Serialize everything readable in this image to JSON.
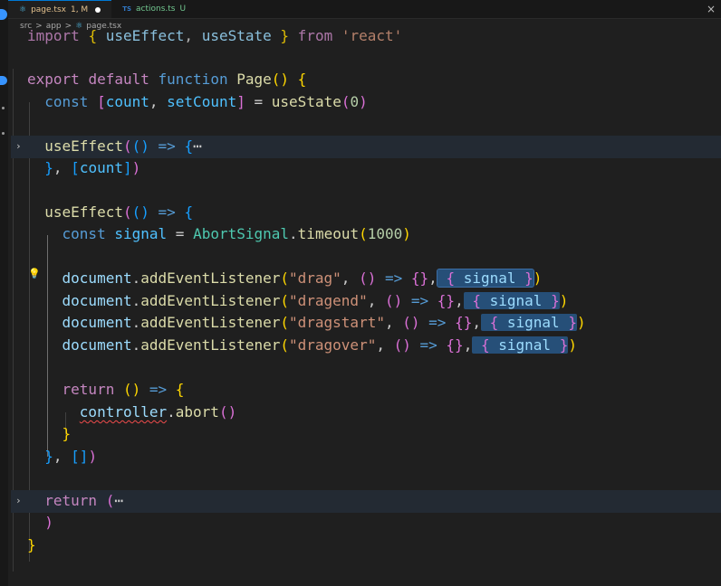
{
  "tabs": [
    {
      "name": "page.tsx",
      "status": "1, M",
      "active": true,
      "modified": true
    },
    {
      "name": "actions.ts",
      "status": "U",
      "active": false,
      "modified": false
    }
  ],
  "ts_badge": "TS",
  "close_glyph": "×",
  "breadcrumb": {
    "folder1": "src",
    "folder2": "app",
    "file": "page.tsx",
    "separator": ">"
  },
  "code": {
    "l0": [
      "import",
      "{",
      "useEffect",
      "useState",
      "}",
      "from",
      "'react'"
    ],
    "l2": [
      "export",
      "default",
      "function",
      "Page",
      "(",
      ")",
      "{"
    ],
    "l3": [
      "const",
      "[",
      "count",
      "setCount",
      "]",
      "=",
      "useState",
      "(",
      "0",
      ")"
    ],
    "l5": [
      "useEffect",
      "(",
      "(",
      ")",
      "=>",
      "{",
      "⋯"
    ],
    "l6": [
      "}",
      "[",
      "count",
      "]",
      ")"
    ],
    "l8": [
      "useEffect",
      "(",
      "(",
      ")",
      "=>",
      "{"
    ],
    "l9": [
      "const",
      "signal",
      "=",
      "AbortSignal",
      ".",
      "timeout",
      "(",
      "1000",
      ")"
    ],
    "listeners": [
      {
        "event": "\"drag\""
      },
      {
        "event": "\"dragend\""
      },
      {
        "event": "\"dragstart\""
      },
      {
        "event": "\"dragover\""
      }
    ],
    "listener_tokens": [
      "document",
      ".",
      "addEventListener",
      "(",
      "(",
      ")",
      "=>",
      "{}",
      "{",
      "signal",
      "}",
      ")"
    ],
    "l16": [
      "return",
      "(",
      ")",
      "=>",
      "{"
    ],
    "l17": [
      "controller",
      ".",
      "abort",
      "(",
      ")"
    ],
    "l18": [
      "}"
    ],
    "l19": [
      "}",
      "[]",
      ")"
    ],
    "l21": [
      "return",
      "(",
      "⋯"
    ],
    "l22": [
      ")"
    ],
    "l23": [
      "}"
    ]
  },
  "colors": {
    "accent": "#0078d4",
    "selection": "#264f78",
    "error": "#f14c4c"
  },
  "icons": {
    "fold": "chevron-right-icon",
    "bulb": "lightbulb-icon",
    "react": "react-file-icon"
  }
}
